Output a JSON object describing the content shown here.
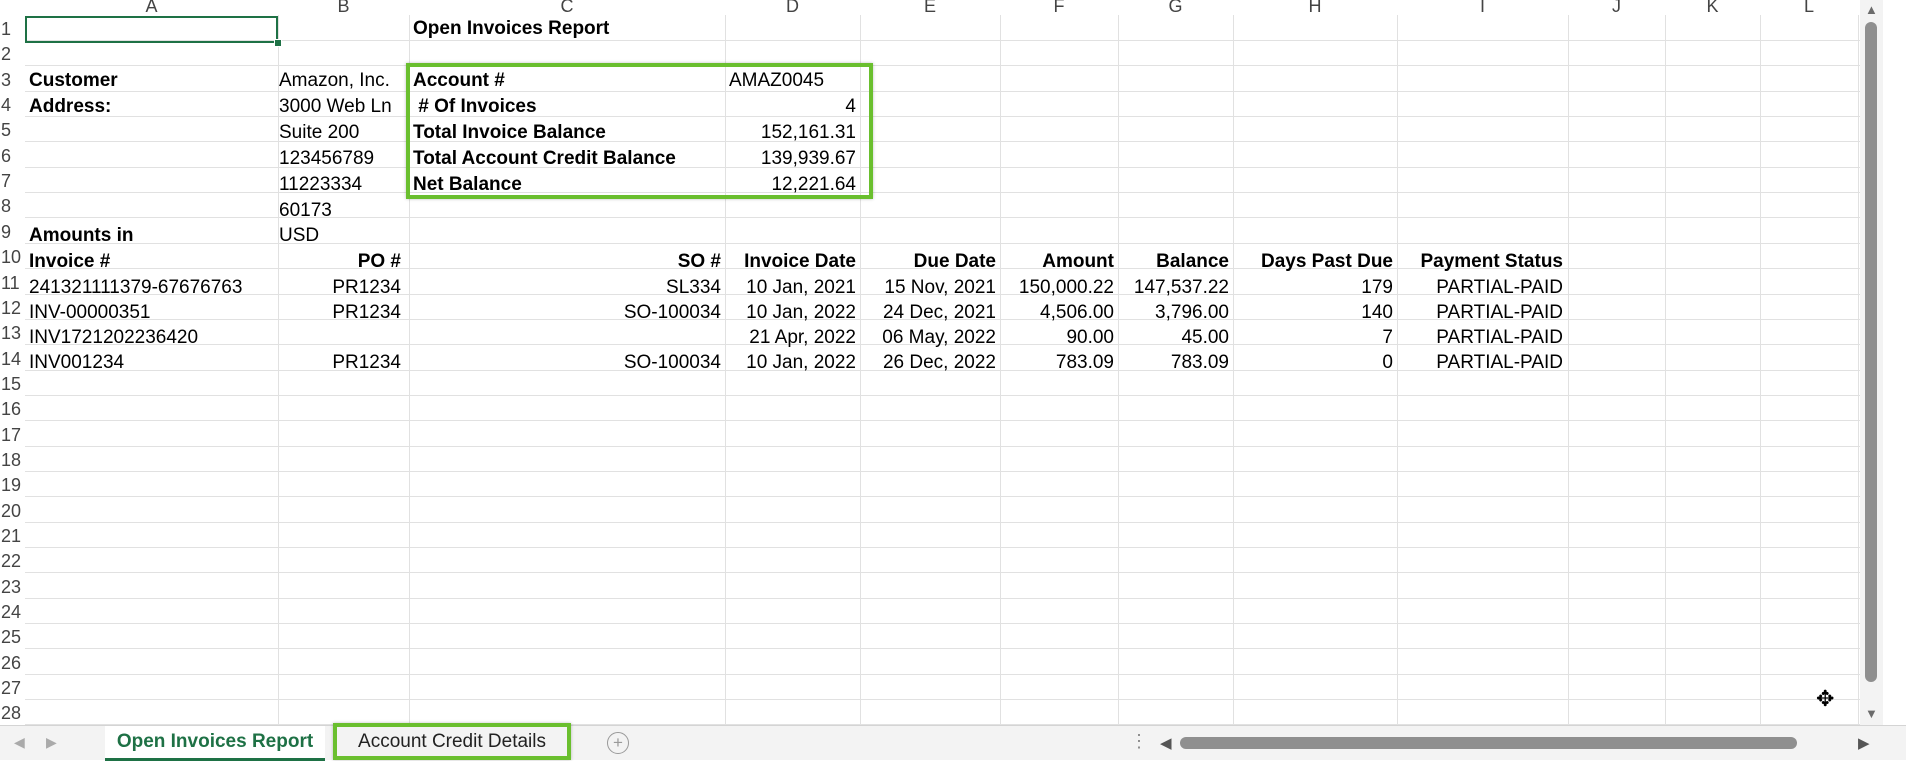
{
  "columns": [
    "A",
    "B",
    "C",
    "D",
    "E",
    "F",
    "G",
    "H",
    "I",
    "J",
    "K",
    "L"
  ],
  "rows": [
    "1",
    "2",
    "3",
    "4",
    "5",
    "6",
    "7",
    "8",
    "9",
    "10",
    "11",
    "12",
    "13",
    "14",
    "15",
    "16",
    "17",
    "18",
    "19",
    "20",
    "21",
    "22",
    "23",
    "24",
    "25",
    "26",
    "27",
    "28"
  ],
  "report": {
    "title": "Open Invoices Report",
    "customer_label": "Customer",
    "customer_value": "Amazon, Inc.",
    "address_label": "Address:",
    "address_lines": [
      "3000 Web Ln",
      "Suite 200",
      "123456789",
      "11223334",
      "60173"
    ],
    "amounts_label": "Amounts in",
    "amounts_value": "USD"
  },
  "summary": {
    "account_label": "Account #",
    "account_value": "AMAZ0045",
    "invoices_label": " # Of Invoices",
    "invoices_value": "4",
    "total_invoice_label": "Total Invoice Balance",
    "total_invoice_value": "152,161.31",
    "total_credit_label": "Total Account Credit Balance",
    "total_credit_value": "139,939.67",
    "net_label": "Net Balance",
    "net_value": "12,221.64"
  },
  "table": {
    "headers": [
      "Invoice #",
      "PO #",
      "SO #",
      "Invoice Date",
      "Due Date",
      "Amount",
      "Balance",
      "Days Past Due",
      "Payment Status"
    ],
    "rows": [
      [
        "241321111379-67676763",
        "PR1234",
        "SL334",
        "10 Jan, 2021",
        "15 Nov, 2021",
        "150,000.22",
        "147,537.22",
        "179",
        "PARTIAL-PAID"
      ],
      [
        "INV-00000351",
        "PR1234",
        "SO-100034",
        "10 Jan, 2022",
        "24 Dec, 2021",
        "4,506.00",
        "3,796.00",
        "140",
        "PARTIAL-PAID"
      ],
      [
        "INV1721202236420",
        "",
        "",
        "21 Apr, 2022",
        "06 May, 2022",
        "90.00",
        "45.00",
        "7",
        "PARTIAL-PAID"
      ],
      [
        "INV001234",
        "PR1234",
        "SO-100034",
        "10 Jan, 2022",
        "26 Dec, 2022",
        "783.09",
        "783.09",
        "0",
        "PARTIAL-PAID"
      ]
    ]
  },
  "tabs": {
    "active": "Open Invoices Report",
    "second": "Account Credit Details"
  },
  "icons": {
    "add_sheet": "plus-circle-icon",
    "nav_prev": "chevron-left-icon",
    "nav_next": "chevron-right-icon",
    "cursor": "move-cursor-icon"
  },
  "colors": {
    "accent": "#1e7145",
    "highlight": "#6abf2e"
  }
}
